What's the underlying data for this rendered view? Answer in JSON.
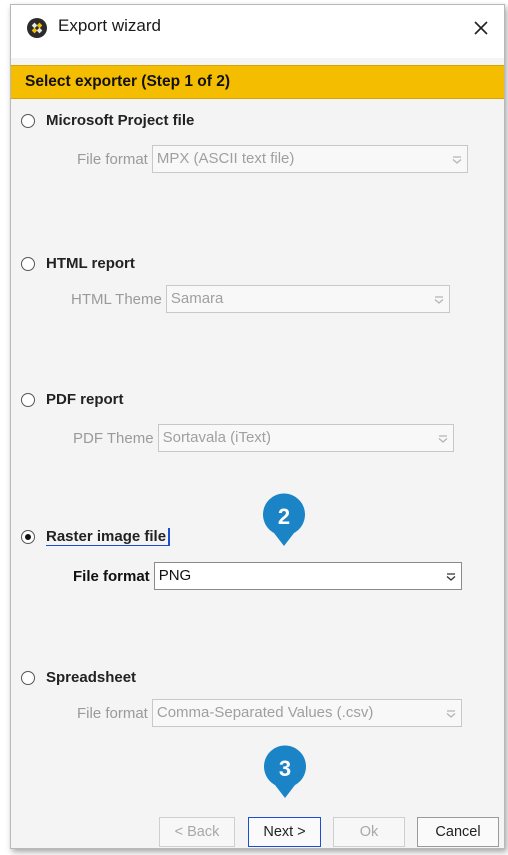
{
  "window": {
    "title": "Export wizard"
  },
  "step_banner": "Select exporter (Step 1 of 2)",
  "options": [
    {
      "label": "Microsoft Project file",
      "selected": false,
      "field_label": "File format",
      "field_value": "MPX (ASCII text file)"
    },
    {
      "label": "HTML report",
      "selected": false,
      "field_label": "HTML Theme",
      "field_value": "Samara"
    },
    {
      "label": "PDF report",
      "selected": false,
      "field_label": "PDF Theme",
      "field_value": "Sortavala (iText)"
    },
    {
      "label": "Raster image file",
      "selected": true,
      "field_label": "File format",
      "field_value": "PNG"
    },
    {
      "label": "Spreadsheet",
      "selected": false,
      "field_label": "File format",
      "field_value": "Comma-Separated Values (.csv)"
    }
  ],
  "badges": {
    "step2": "2",
    "step3": "3"
  },
  "buttons": {
    "back": "< Back",
    "next": "Next >",
    "ok": "Ok",
    "cancel": "Cancel"
  },
  "colors": {
    "banner": "#f5bd00",
    "badge": "#1a84c7",
    "focus": "#1a4fd4"
  },
  "icons": {
    "app": "app-logo-icon",
    "close": "close-icon",
    "dropdown": "dropdown-arrow-icon"
  }
}
